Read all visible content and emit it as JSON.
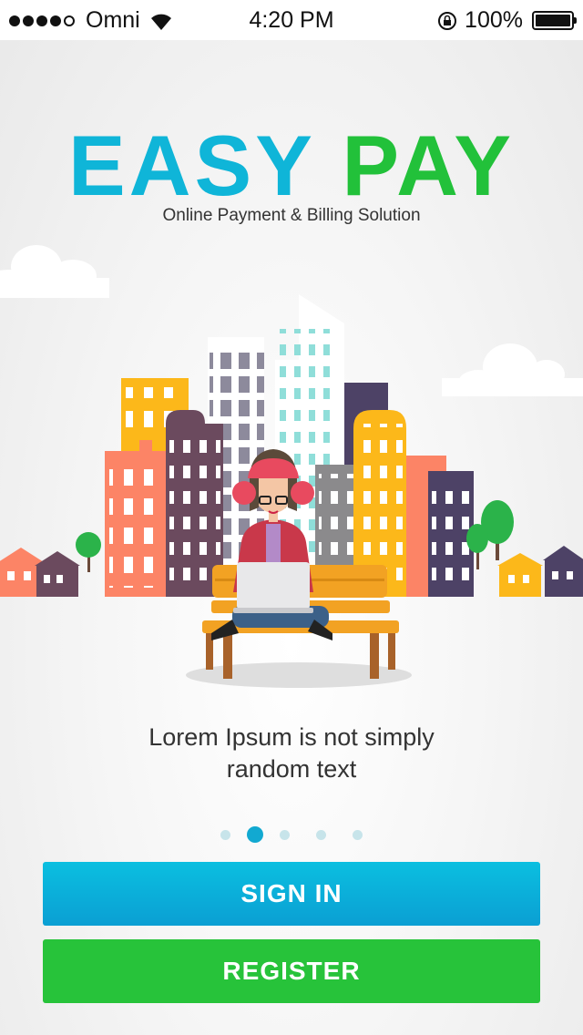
{
  "status_bar": {
    "carrier": "Omni",
    "time": "4:20 PM",
    "battery": "100%",
    "icons": [
      "signal-dots-icon",
      "wifi-icon",
      "rotation-lock-icon",
      "battery-icon"
    ]
  },
  "brand": {
    "word1": "EASY",
    "word2": "PAY",
    "tagline": "Online Payment & Billing Solution",
    "colors": {
      "word1": "#0fb5d8",
      "word2": "#22c13a"
    }
  },
  "onboarding": {
    "caption": "Lorem Ipsum is not simply random text",
    "page_count": 5,
    "active_page": 2
  },
  "actions": {
    "signin_label": "SIGN IN",
    "register_label": "REGISTER",
    "colors": {
      "signin": "#0bb0db",
      "register": "#27c33a"
    }
  }
}
